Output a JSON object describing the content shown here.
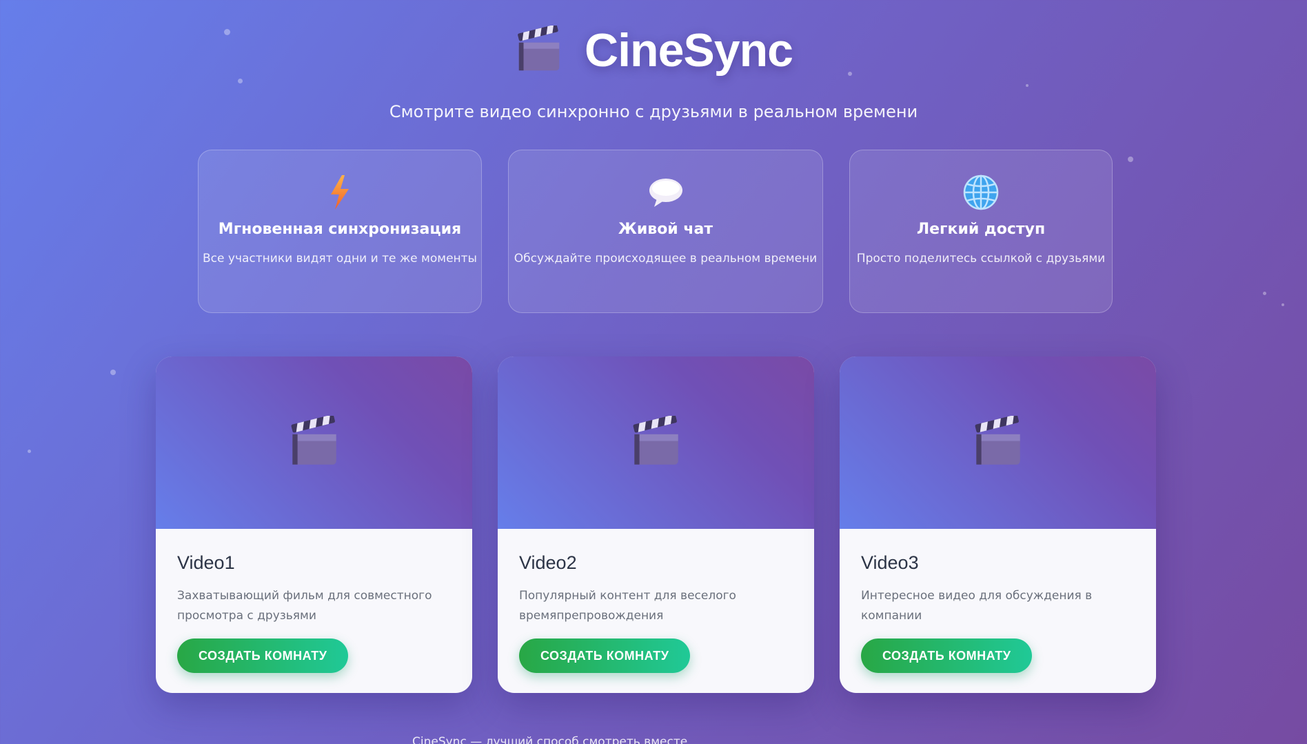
{
  "header": {
    "title": "CineSync",
    "subtitle": "Смотрите видео синхронно с друзьями в реальном времени"
  },
  "features": [
    {
      "icon": "lightning-icon",
      "title": "Мгновенная синхронизация",
      "desc": "Все участники видят одни и те же моменты"
    },
    {
      "icon": "speech-bubble-icon",
      "title": "Живой чат",
      "desc": "Обсуждайте происходящее в реальном времени"
    },
    {
      "icon": "globe-icon",
      "title": "Легкий доступ",
      "desc": "Просто поделитесь ссылкой с друзьями"
    }
  ],
  "videos": [
    {
      "title": "Video1",
      "desc": "Захватывающий фильм для совместного просмотра с друзьями",
      "button": "СОЗДАТЬ КОМНАТУ"
    },
    {
      "title": "Video2",
      "desc": "Популярный контент для веселого времяпрепровождения",
      "button": "СОЗДАТЬ КОМНАТУ"
    },
    {
      "title": "Video3",
      "desc": "Интересное видео для обсуждения в компании",
      "button": "СОЗДАТЬ КОМНАТУ"
    }
  ],
  "footer": {
    "text": "CineSync — лучший способ смотреть вместе"
  },
  "colors": {
    "bg_start": "#667eea",
    "bg_end": "#764ba2",
    "button_start": "#28a745",
    "button_end": "#20c997"
  }
}
